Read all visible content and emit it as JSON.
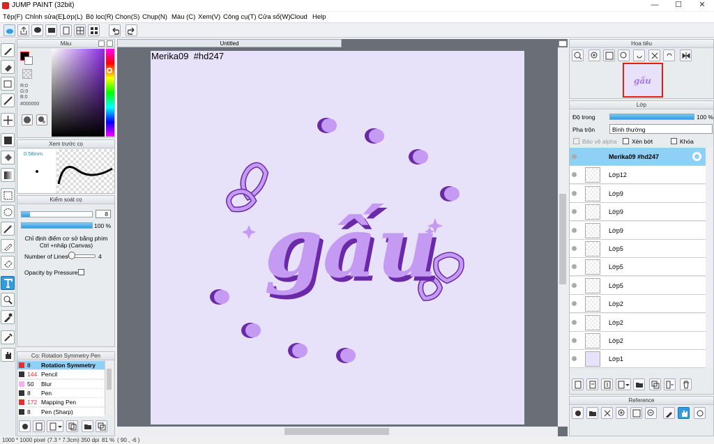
{
  "window": {
    "title": "JUMP PAINT (32bit)"
  },
  "menu": [
    "Tệp(F)",
    "Chỉnh sửa(E)",
    "Lớp(L)",
    "Bộ lọc(R)",
    "Chọn(S)",
    "Chụp(N)",
    "Màu (C)",
    "Xem(V)",
    "Công cụ(T)",
    "Cửa sổ(W)",
    "Cloud",
    "Help"
  ],
  "document": {
    "tab": "Untitled",
    "canvas_text": "Merika09  #hd247",
    "artwork_text": "gấu"
  },
  "color_panel": {
    "title": "Màu",
    "r": "R:0",
    "g": "G:0",
    "b": "B:0",
    "hex": "#000000"
  },
  "brush_preview": {
    "title": "Xem trước cọ",
    "size": "0.58mm"
  },
  "brush_control": {
    "title": "Kiểm soát cọ",
    "size_value": "8",
    "opacity_value": 100,
    "opacity_label": "100 %",
    "hint": "Chỉ định điểm cơ sở bằng phím Ctrl +nhấp (Canvas)",
    "lines_label": "Number of Lines",
    "lines_value": "4",
    "pressure_label": "Opacity by Pressure"
  },
  "brush_list": {
    "title": "Cọ: Rotation Symmetry Pen",
    "items": [
      {
        "size": "8",
        "name": "Rotation Symmetry",
        "color": "#e03030",
        "selected": true
      },
      {
        "size": "144",
        "name": "Pencil",
        "color": "#333333",
        "selected": false
      },
      {
        "size": "50",
        "name": "Blur",
        "color": "#f4b0f0",
        "selected": false
      },
      {
        "size": "8",
        "name": "Pen",
        "color": "#333333",
        "selected": false
      },
      {
        "size": "172",
        "name": "Mapping Pen",
        "color": "#e03030",
        "selected": false
      },
      {
        "size": "8",
        "name": "Pen (Sharp)",
        "color": "#333333",
        "selected": false
      }
    ]
  },
  "navigator": {
    "title": "Hoa tiêu"
  },
  "layers": {
    "title": "Lớp",
    "opacity_label": "Độ trong",
    "opacity_value": 100,
    "opacity_text": "100 %",
    "blend_label": "Pha trộn",
    "blend_value": "Bình thường",
    "protect_alpha": "Bảo vệ alpha",
    "clipping": "Xén bớt",
    "lock": "Khóa",
    "items": [
      "Merika09  #hd247",
      "Lớp12",
      "Lớp9",
      "Lớp9",
      "Lớp9",
      "Lớp5",
      "Lớp5",
      "Lớp5",
      "Lớp2",
      "Lớp2",
      "Lớp2",
      "Lớp1"
    ]
  },
  "reference": {
    "title": "Reference"
  },
  "status": {
    "size": "1000 * 1000 pixel",
    "cm": "(7.3 * 7.3cm)",
    "dpi": "350 dpi",
    "zoom": "81 %",
    "coords": "( 90 , -6 )"
  },
  "colors": {
    "accent": "#2f9de0",
    "canvas_bg": "#e8e1fa",
    "art_light": "#c49af2",
    "art_dark": "#6a2aa8"
  }
}
